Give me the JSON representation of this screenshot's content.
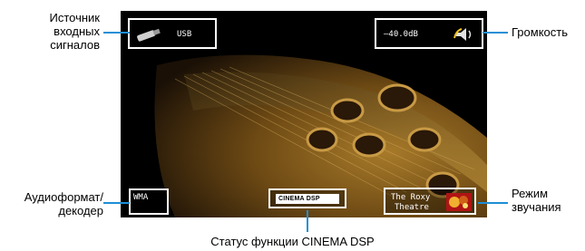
{
  "callouts": {
    "input_source": {
      "lines": [
        "Источник",
        "входных",
        "сигналов"
      ]
    },
    "volume": "Громкость",
    "audio_format": {
      "lines": [
        "Аудиоформат/",
        "декодер"
      ]
    },
    "sound_mode": {
      "lines": [
        "Режим",
        "звучания"
      ]
    },
    "cinema_dsp_status": "Статус функции CINEMA DSP"
  },
  "osd": {
    "input": "USB",
    "volume": "–40.0dB",
    "audio_format": "WMA",
    "dsp_logo": "CINEMA DSP",
    "sound_mode_line1": "The Roxy",
    "sound_mode_line2": "Theatre"
  },
  "colors": {
    "callout_line": "#1e8fd6",
    "osd_border": "#ffffff"
  }
}
